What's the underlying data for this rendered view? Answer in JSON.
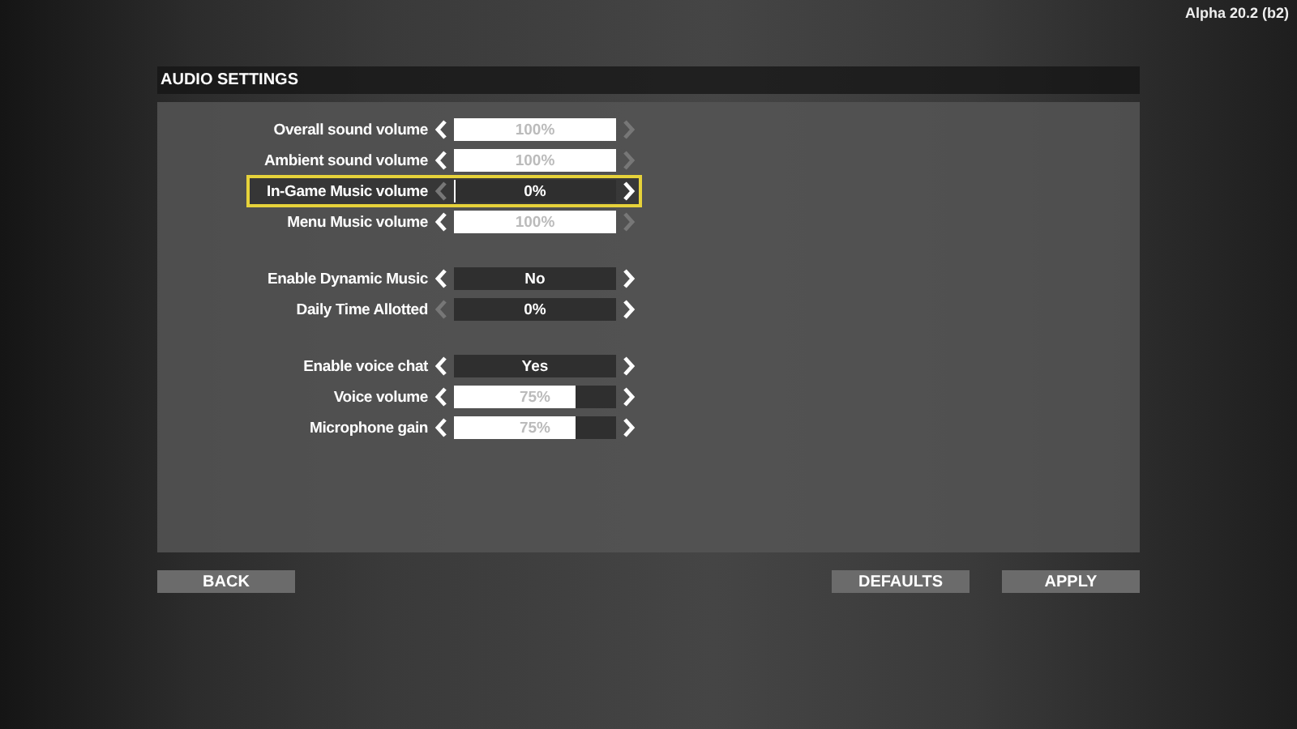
{
  "version": "Alpha 20.2 (b2)",
  "title": "AUDIO SETTINGS",
  "groups": [
    {
      "rows": [
        {
          "label": "Overall sound volume",
          "kind": "slider",
          "value": "100%",
          "level": 1,
          "left_enabled": true,
          "right_enabled": false,
          "selected": false
        },
        {
          "label": "Ambient sound volume",
          "kind": "slider",
          "value": "100%",
          "level": 1,
          "left_enabled": true,
          "right_enabled": false,
          "selected": false
        },
        {
          "label": "In-Game Music volume",
          "kind": "slider",
          "value": "0%",
          "level": 0,
          "left_enabled": false,
          "right_enabled": true,
          "selected": true
        },
        {
          "label": "Menu Music volume",
          "kind": "slider",
          "value": "100%",
          "level": 1,
          "left_enabled": true,
          "right_enabled": false,
          "selected": false
        }
      ]
    },
    {
      "rows": [
        {
          "label": "Enable Dynamic Music",
          "kind": "choice",
          "value": "No",
          "left_enabled": true,
          "right_enabled": true,
          "selected": false
        },
        {
          "label": "Daily Time Allotted",
          "kind": "choice",
          "value": "0%",
          "left_enabled": false,
          "right_enabled": true,
          "selected": false
        }
      ]
    },
    {
      "rows": [
        {
          "label": "Enable voice chat",
          "kind": "choice",
          "value": "Yes",
          "left_enabled": true,
          "right_enabled": true,
          "selected": false
        },
        {
          "label": "Voice volume",
          "kind": "slider",
          "value": "75%",
          "level": 0.75,
          "left_enabled": true,
          "right_enabled": true,
          "selected": false
        },
        {
          "label": "Microphone gain",
          "kind": "slider",
          "value": "75%",
          "level": 0.75,
          "left_enabled": true,
          "right_enabled": true,
          "selected": false
        }
      ]
    }
  ],
  "buttons_left": [
    "BACK"
  ],
  "buttons_right": [
    "DEFAULTS",
    "APPLY"
  ]
}
